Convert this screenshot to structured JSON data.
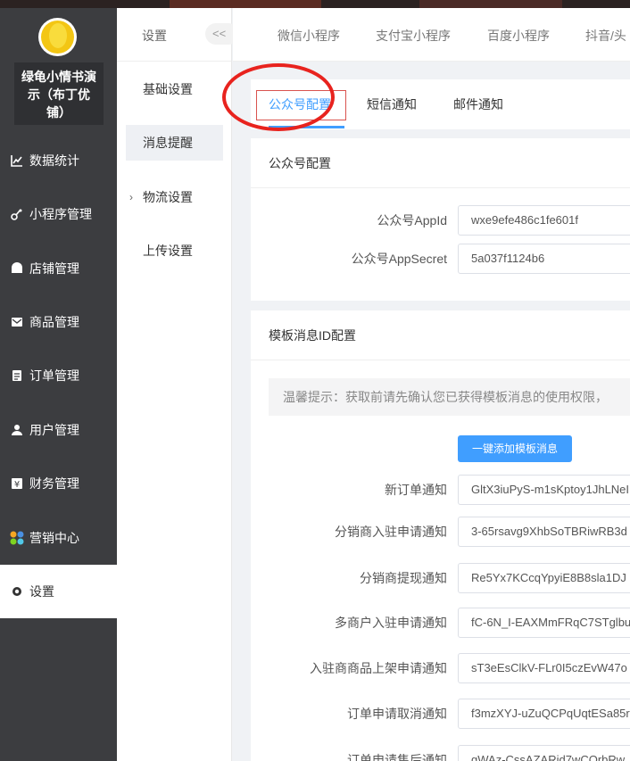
{
  "sidebar": {
    "shop_name_line1": "绿龟小情书演",
    "shop_name_line2": "示（布丁优",
    "shop_name_line3": "铺）",
    "items": [
      {
        "label": "数据统计",
        "icon": "chart-icon"
      },
      {
        "label": "小程序管理",
        "icon": "link-icon"
      },
      {
        "label": "店铺管理",
        "icon": "shop-icon"
      },
      {
        "label": "商品管理",
        "icon": "mail-icon"
      },
      {
        "label": "订单管理",
        "icon": "clipboard-icon"
      },
      {
        "label": "用户管理",
        "icon": "user-icon"
      },
      {
        "label": "财务管理",
        "icon": "yen-icon"
      },
      {
        "label": "营销中心",
        "icon": "colorful-grid-icon"
      },
      {
        "label": "设置",
        "icon": "gear-icon"
      }
    ]
  },
  "subnav": {
    "title": "设置",
    "collapse": "<<",
    "items": [
      {
        "label": "基础设置"
      },
      {
        "label": "消息提醒"
      },
      {
        "label": "物流设置"
      },
      {
        "label": "上传设置"
      }
    ]
  },
  "toptabs": [
    "微信小程序",
    "支付宝小程序",
    "百度小程序",
    "抖音/头"
  ],
  "tabs": [
    "公众号配置",
    "短信通知",
    "邮件通知"
  ],
  "public_account": {
    "title": "公众号配置",
    "appid_label": "公众号AppId",
    "appid_value": "wxe9efe486c1fe601f",
    "secret_label": "公众号AppSecret",
    "secret_value": "5a037f1124b6"
  },
  "template": {
    "title": "模板消息ID配置",
    "tip": "温馨提示：获取前请先确认您已获得模板消息的使用权限，",
    "add_button": "一键添加模板消息",
    "rows": [
      {
        "label": "新订单通知",
        "value": "GltX3iuPyS-m1sKptoy1JhLNeI"
      },
      {
        "label": "分销商入驻申请通知",
        "value": "3-65rsavg9XhbSoTBRiwRB3d"
      },
      {
        "label": "分销商提现通知",
        "value": "Re5Yx7KCcqYpyiE8B8sla1DJ"
      },
      {
        "label": "多商户入驻申请通知",
        "value": "fC-6N_I-EAXMmFRqC7STglbu"
      },
      {
        "label": "入驻商商品上架申请通知",
        "value": "sT3eEsClkV-FLr0I5czEvW47o"
      },
      {
        "label": "订单申请取消通知",
        "value": "f3mzXYJ-uZuQCPqUqtESa85r"
      },
      {
        "label": "订单申请售后通知",
        "value": "gWAz-CssAZARid7wCQrbRw"
      }
    ]
  },
  "colors": {
    "accent": "#409eff",
    "sidebar": "#3c3d40",
    "highlight": "#e8231e"
  }
}
